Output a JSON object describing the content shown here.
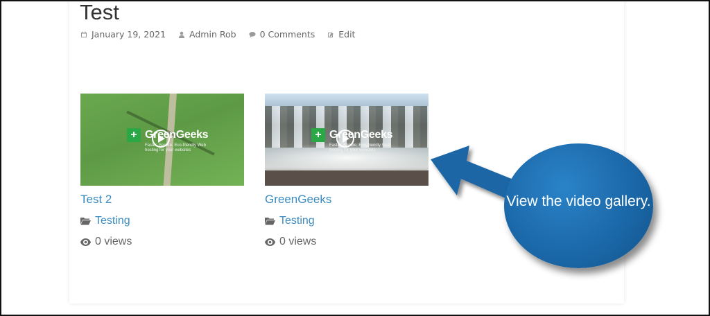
{
  "post": {
    "title": "Test",
    "meta": {
      "date": "January 19, 2021",
      "author": "Admin Rob",
      "comments": "0 Comments",
      "edit": "Edit"
    }
  },
  "videos": [
    {
      "title": "Test 2",
      "category": "Testing",
      "views": "0 views",
      "thumbnail": "wind-turbine-aerial",
      "brand": "GreenGeeks",
      "brand_tagline": "Faster, Secure, Eco-friendly Web hosting for your websites"
    },
    {
      "title": "GreenGeeks",
      "category": "Testing",
      "views": "0 views",
      "thumbnail": "waterfall",
      "brand": "GreenGeeks",
      "brand_tagline": "Faster, Secure, Eco-friendly Web hosting for your websites"
    }
  ],
  "callout": {
    "text": "View the video gallery.",
    "color": "#1a66a6"
  },
  "colors": {
    "link": "#3a8bbf",
    "meta": "#666666",
    "brand_green": "#2aa845"
  },
  "icons": [
    "calendar-icon",
    "user-icon",
    "comment-icon",
    "edit-icon",
    "folder-icon",
    "eye-icon",
    "play-icon"
  ]
}
